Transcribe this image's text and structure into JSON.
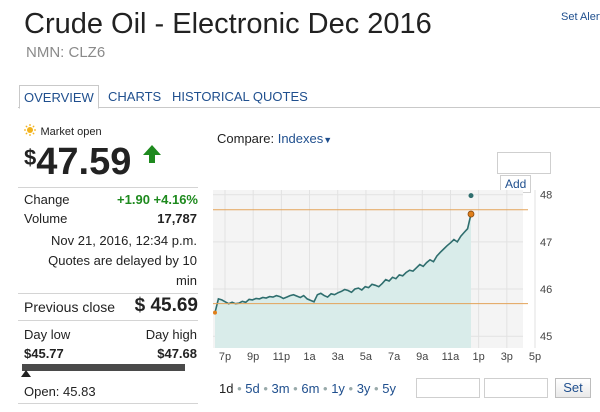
{
  "header": {
    "title": "Crude Oil - Electronic Dec 2016",
    "ticker": "NMN: CLZ6",
    "set_alert": "Set Alert"
  },
  "tabs": [
    {
      "label": "OVERVIEW",
      "active": true
    },
    {
      "label": "CHARTS",
      "active": false
    },
    {
      "label": "HISTORICAL QUOTES",
      "active": false
    }
  ],
  "quote": {
    "market_status": "Market open",
    "currency_symbol": "$",
    "price": "47.59",
    "direction": "up",
    "change_label": "Change",
    "change_value": "+1.90 +4.16%",
    "volume_label": "Volume",
    "volume_value": "17,787",
    "timestamp": "Nov 21, 2016, 12:34 p.m.",
    "delay_note_1": "Quotes are delayed by 10",
    "delay_note_2": "min",
    "previous_close_label": "Previous close",
    "previous_close_value": "$ 45.69",
    "day_low_label": "Day low",
    "day_high_label": "Day high",
    "day_low_value": "$45.77",
    "day_high_value": "$47.68",
    "open_label": "Open: 45.83",
    "day_range_fraction": 0.0
  },
  "compare": {
    "label": "Compare:",
    "link": "Indexes",
    "add_button": "Add"
  },
  "colors": {
    "up_green": "#1e8a1e",
    "link_blue": "#1f4f8e",
    "series_line": "#2f6e6e",
    "area_fill": "#d9ecea",
    "prev_close_line": "#e3a35a",
    "last_point": "#e07f1a"
  },
  "chart_data": {
    "type": "area",
    "x_ticks": [
      "7p",
      "9p",
      "11p",
      "1a",
      "3a",
      "5a",
      "7a",
      "9a",
      "11a",
      "1p",
      "3p",
      "5p"
    ],
    "y_ticks": [
      "48",
      "47",
      "46",
      "45"
    ],
    "ylim": [
      44.75,
      48.1
    ],
    "previous_close": 45.69,
    "marker_high": 47.68,
    "series": [
      {
        "values": [
          45.5,
          45.79,
          45.77,
          45.73,
          45.69,
          45.72,
          45.69,
          45.7,
          45.74,
          45.72,
          45.78,
          45.77,
          45.8,
          45.79,
          45.82,
          45.81,
          45.84,
          45.83,
          45.86,
          45.84,
          45.8,
          45.83,
          45.86,
          45.88,
          45.85,
          45.82,
          45.86,
          45.79,
          45.76,
          45.73,
          45.88,
          45.91,
          45.86,
          45.83,
          45.9,
          45.88,
          45.92,
          45.95,
          45.99,
          45.97,
          45.93,
          46.0,
          46.02,
          45.98,
          46.05,
          46.03,
          46.1,
          46.08,
          46.05,
          46.12,
          46.2,
          46.17,
          46.25,
          46.22,
          46.3,
          46.28,
          46.35,
          46.4,
          46.38,
          46.45,
          46.52,
          46.48,
          46.56,
          46.62,
          46.58,
          46.7,
          46.78,
          46.85,
          46.92,
          46.98,
          47.05,
          47.0,
          47.12,
          47.2,
          47.28,
          47.59
        ]
      }
    ],
    "range_buttons": [
      "1d",
      "5d",
      "3m",
      "6m",
      "1y",
      "3y",
      "5y"
    ],
    "active_range": "1d",
    "set_button": "Set"
  }
}
